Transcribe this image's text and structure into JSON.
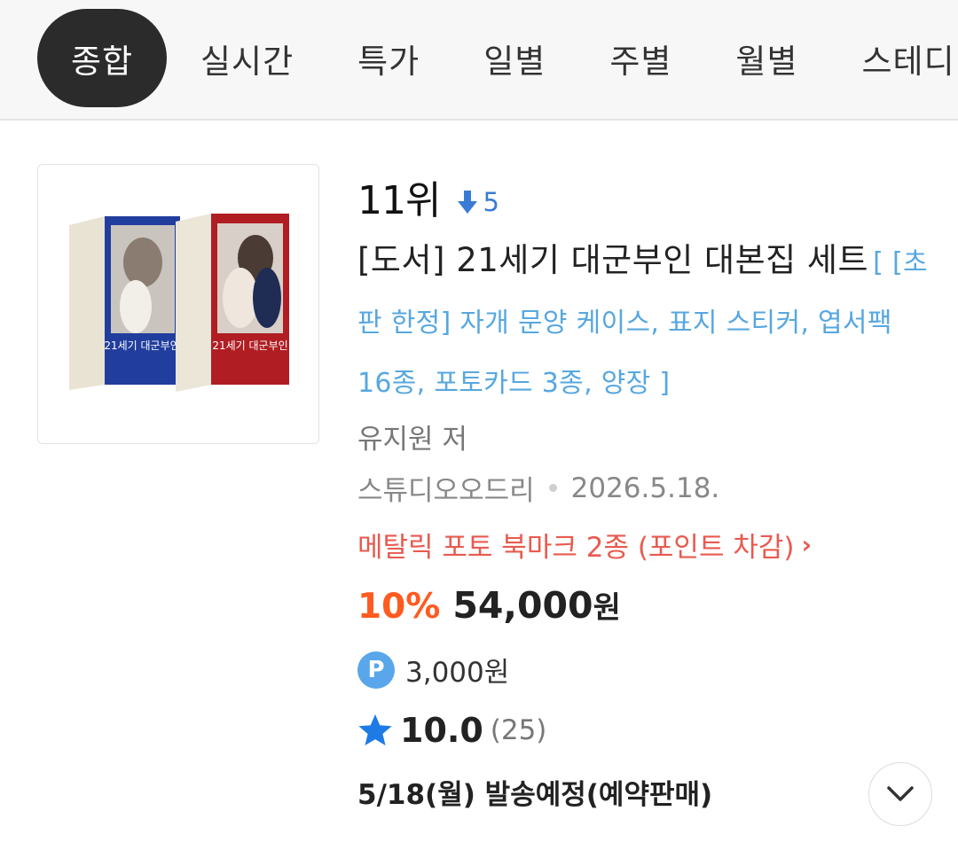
{
  "tabs": [
    {
      "label": "종합",
      "active": true
    },
    {
      "label": "실시간",
      "active": false
    },
    {
      "label": "특가",
      "active": false
    },
    {
      "label": "일별",
      "active": false
    },
    {
      "label": "주별",
      "active": false
    },
    {
      "label": "월별",
      "active": false
    },
    {
      "label": "스테디",
      "active": false
    }
  ],
  "product": {
    "rank": "11위",
    "rank_change": "5",
    "rank_change_direction": "down",
    "title_main": "[도서] 21세기 대군부인 대본집 세트",
    "title_sub": "[ [초판 한정] 자개 문양 케이스, 표지 스티커, 엽서팩 16종, 포토카드 3종, 양장 ]",
    "cover_text_1": "21세기 대군부인",
    "cover_text_2": "21세기 대군부인",
    "author": "유지원 저",
    "publisher": "스튜디오오드리",
    "date": "2026.5.18.",
    "promo": "메탈릭 포토 북마크 2종 (포인트 차감)",
    "promo_arrow": "›",
    "discount": "10%",
    "price": "54,000",
    "currency": "원",
    "points": "3,000원",
    "points_badge": "P",
    "rating": "10.0",
    "review_count": "(25)",
    "shipping": "5/18(월) 발송예정(예약판매)"
  },
  "colors": {
    "accent_orange": "#ff5a1f",
    "link_blue": "#57a7e0",
    "promo_red": "#e85a4f",
    "star_blue": "#1e7be6",
    "active_tab_bg": "#2b2b2b"
  },
  "icons": {
    "rank_change": "arrow-down-icon",
    "rating": "star-icon",
    "expand": "chevron-down-icon",
    "points": "p-badge-icon"
  }
}
